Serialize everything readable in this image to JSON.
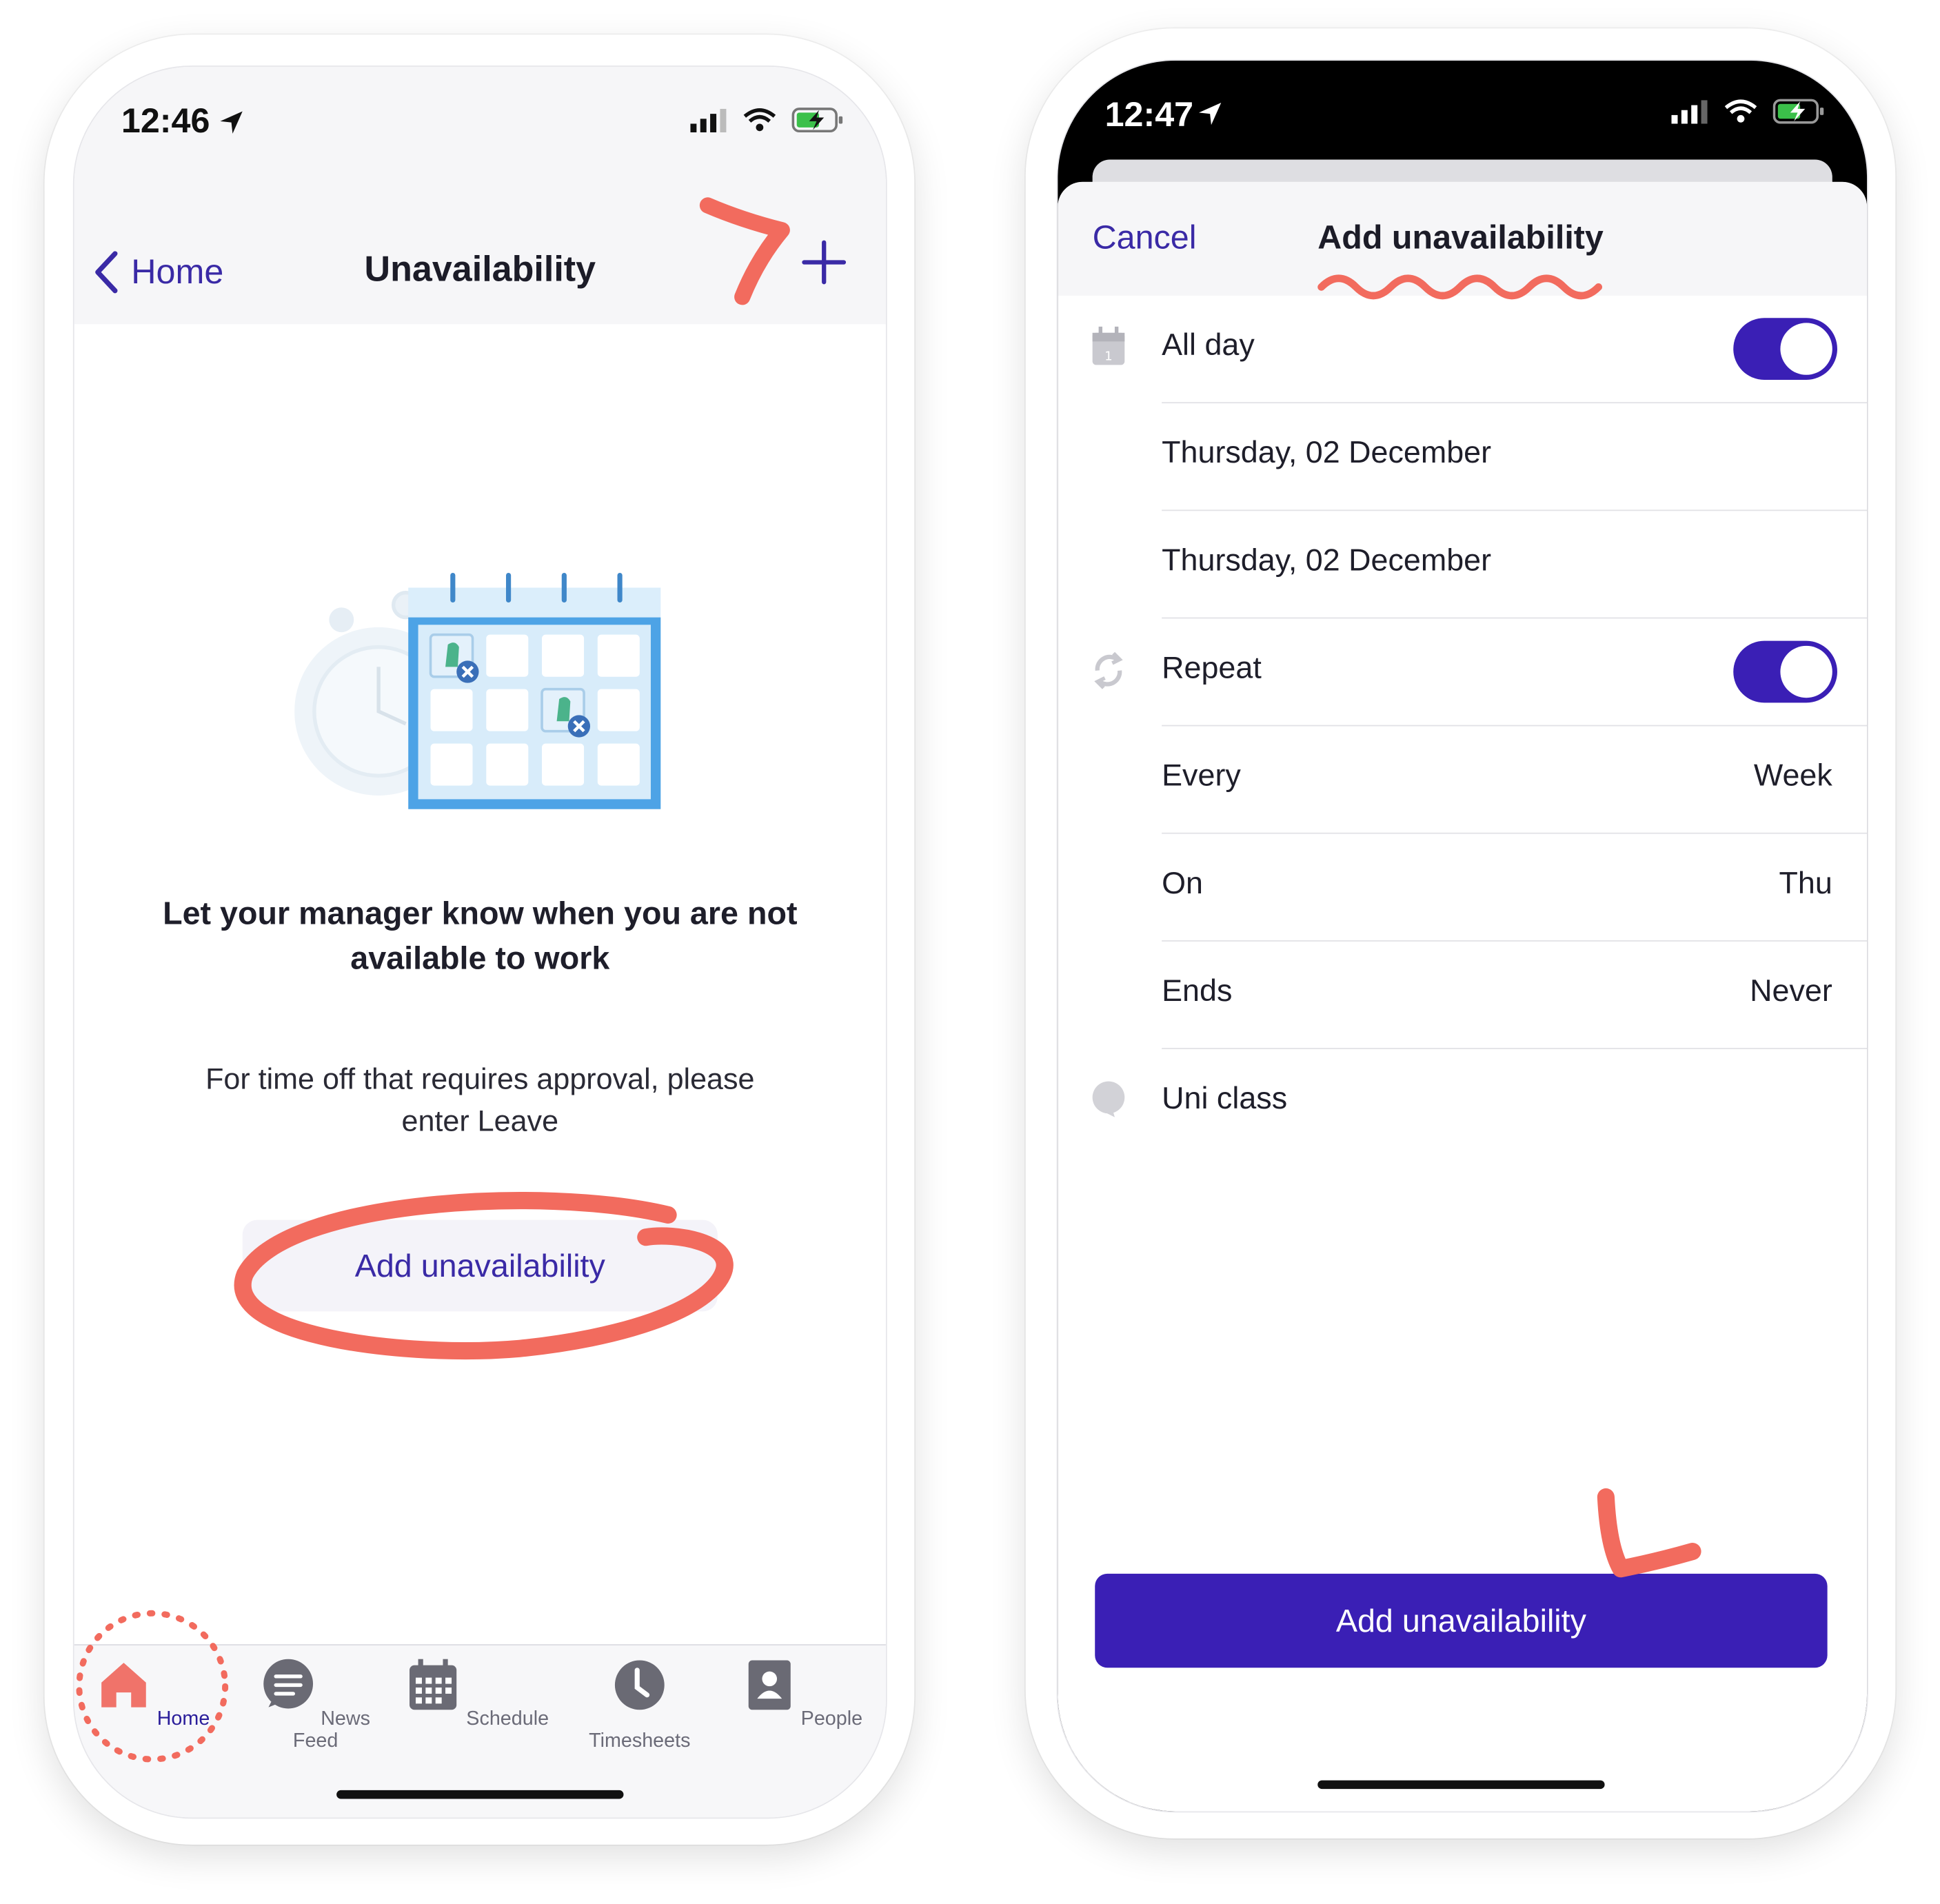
{
  "left_screen": {
    "status": {
      "time": "12:46"
    },
    "nav": {
      "back_label": "Home",
      "title": "Unavailability"
    },
    "headline": "Let your manager know when you are not available to work",
    "subtext": "For time off that requires approval, please enter Leave",
    "add_button": "Add unavailability",
    "tabs": [
      {
        "label": "Home",
        "icon": "home-icon",
        "active": true
      },
      {
        "label": "News Feed",
        "icon": "news-feed-icon",
        "active": false
      },
      {
        "label": "Schedule",
        "icon": "schedule-icon",
        "active": false
      },
      {
        "label": "Timesheets",
        "icon": "timesheets-icon",
        "active": false
      },
      {
        "label": "People",
        "icon": "people-icon",
        "active": false
      }
    ]
  },
  "right_screen": {
    "status": {
      "time": "12:47"
    },
    "nav": {
      "cancel_label": "Cancel",
      "title": "Add unavailability"
    },
    "rows": {
      "all_day": {
        "label": "All day",
        "toggle": true
      },
      "start_date": {
        "label": "Thursday, 02 December"
      },
      "end_date": {
        "label": "Thursday, 02 December"
      },
      "repeat": {
        "label": "Repeat",
        "toggle": true
      },
      "every": {
        "label": "Every",
        "value": "Week"
      },
      "on": {
        "label": "On",
        "value": "Thu"
      },
      "ends": {
        "label": "Ends",
        "value": "Never"
      },
      "note": {
        "label": "Uni class"
      }
    },
    "submit_button": "Add unavailability"
  },
  "colors": {
    "accent": "#3a1fb5",
    "link": "#3a2aa6",
    "annotation": "#f26b5e",
    "home_tab": "#f0736a"
  }
}
